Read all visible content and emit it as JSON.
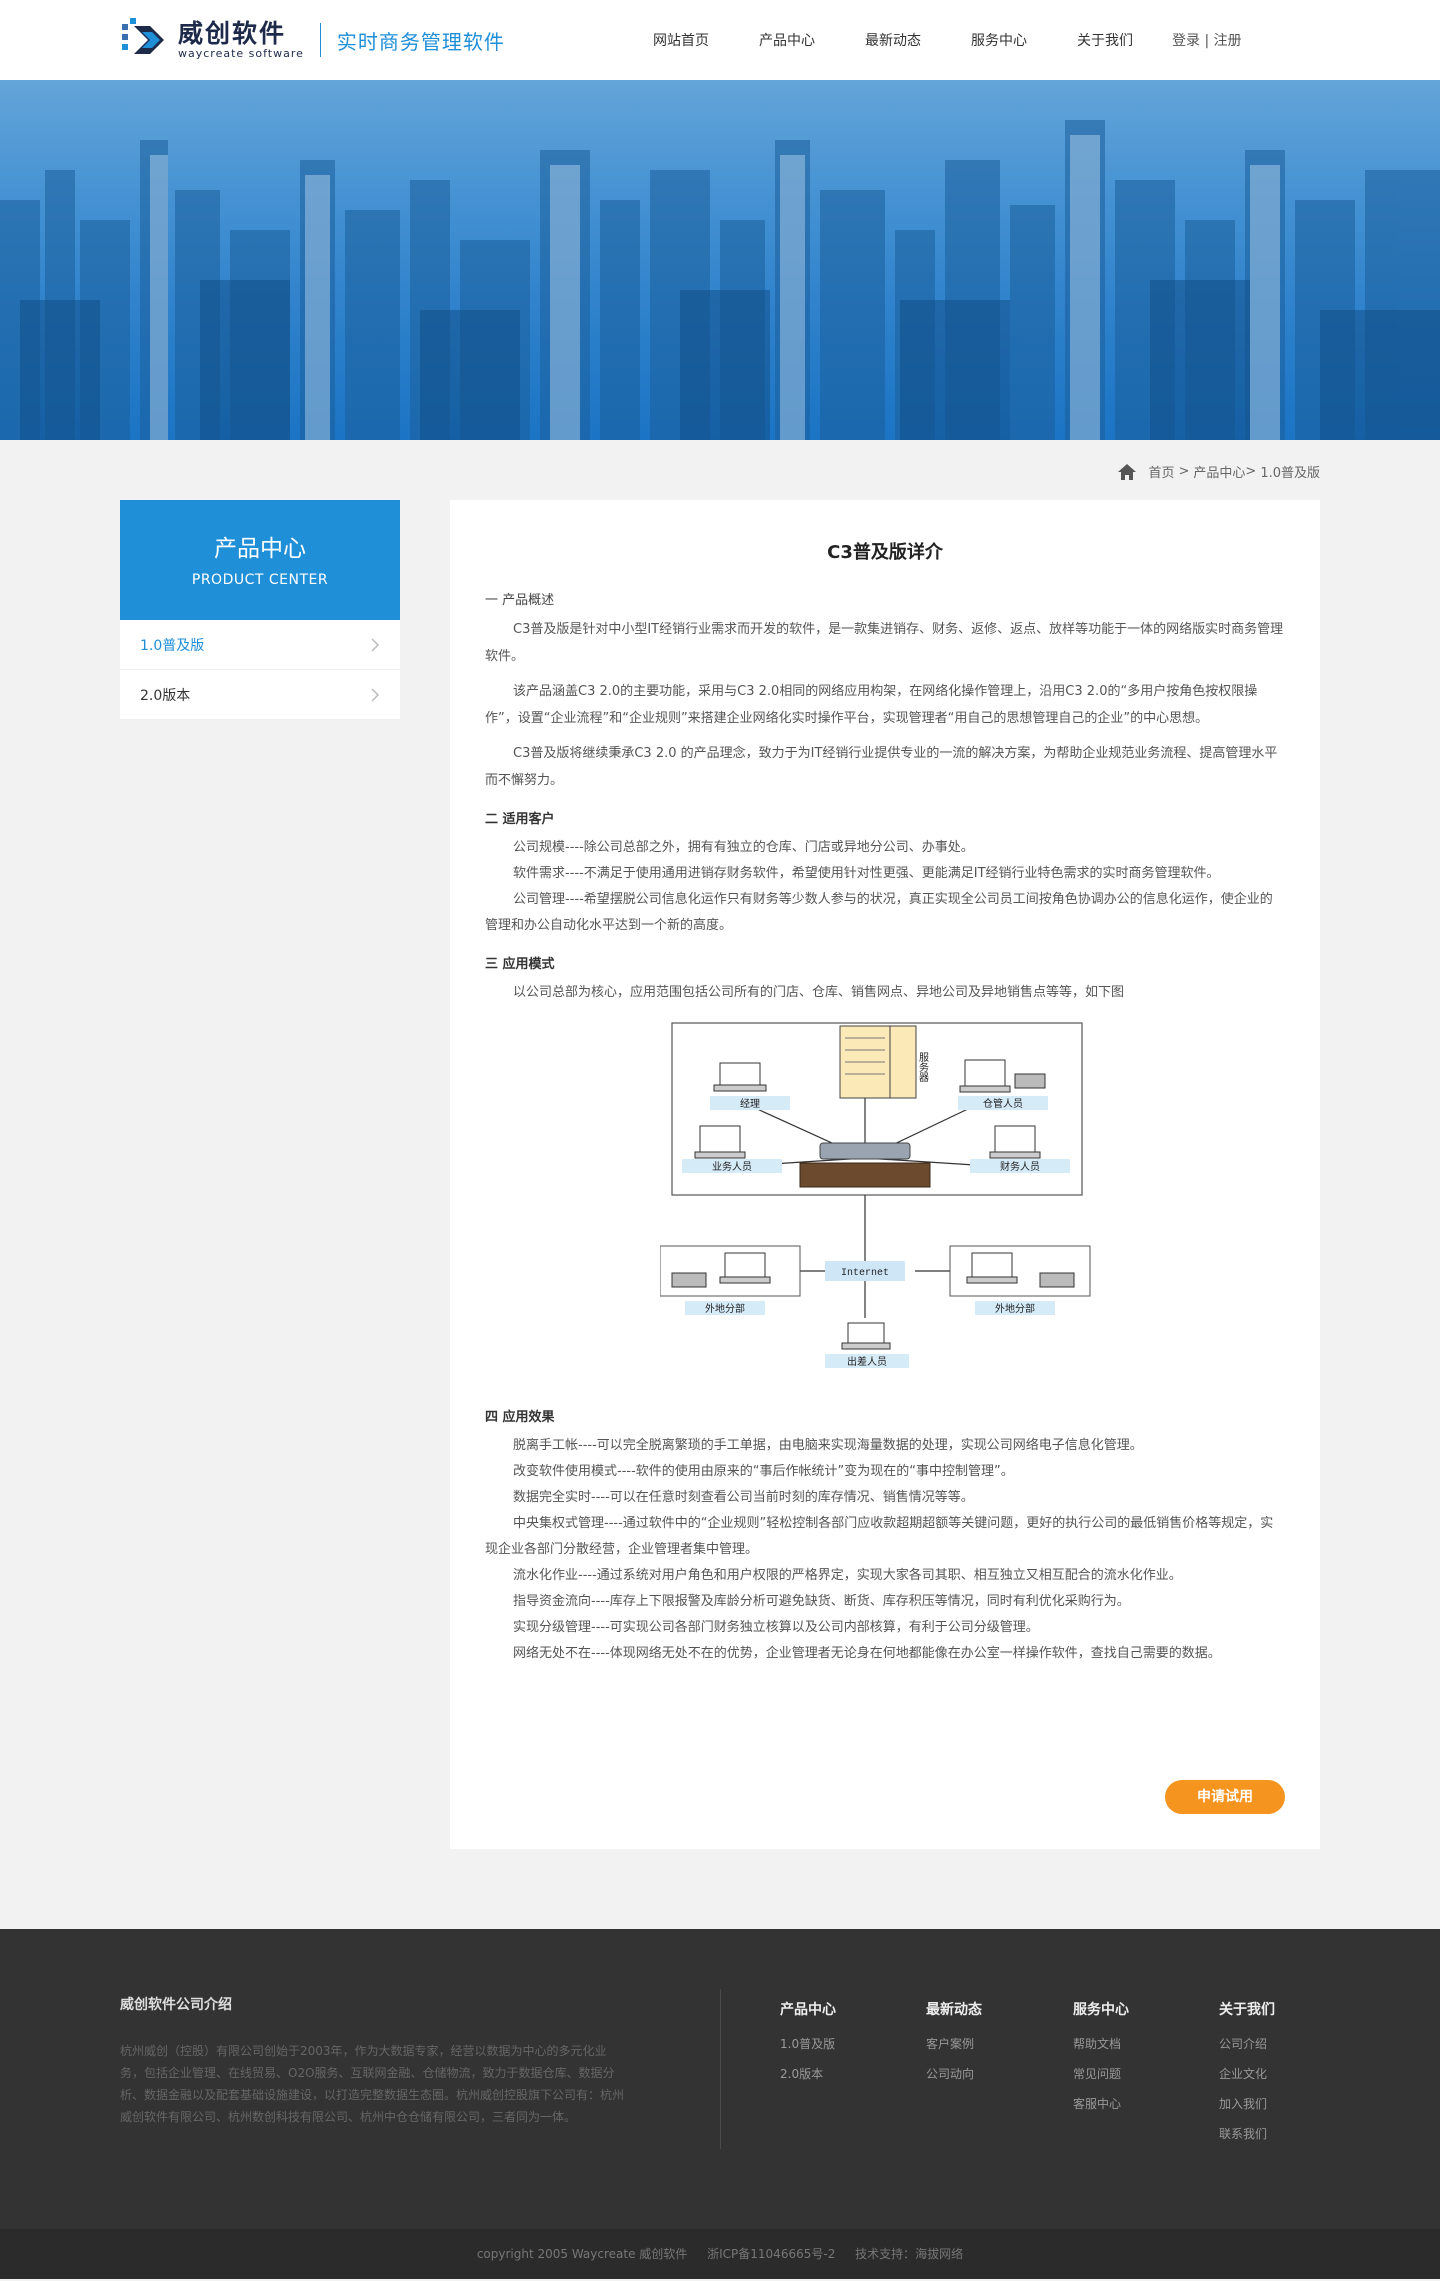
{
  "header": {
    "logo_cn": "威创软件",
    "logo_en": "waycreate software",
    "slogan": "实时商务管理软件",
    "nav": [
      "网站首页",
      "产品中心",
      "最新动态",
      "服务中心",
      "关于我们"
    ],
    "login": "登录",
    "separator": "|",
    "register": "注册"
  },
  "breadcrumb": {
    "home": "首页",
    "sep1": ">",
    "section": "产品中心",
    "sep2": ">",
    "current": "1.0普及版"
  },
  "sidebar": {
    "title_cn": "产品中心",
    "title_en": "PRODUCT CENTER",
    "items": [
      "1.0普及版",
      "2.0版本"
    ]
  },
  "article": {
    "title": "C3普及版详介",
    "s1_title": "一 产品概述",
    "s1_p1": "C3普及版是针对中小型IT经销行业需求而开发的软件，是一款集进销存、财务、返修、返点、放样等功能于一体的网络版实时商务管理软件。",
    "s1_p2": "该产品涵盖C3 2.0的主要功能，采用与C3 2.0相同的网络应用构架，在网络化操作管理上，沿用C3 2.0的“多用户按角色按权限操作”，设置“企业流程”和“企业规则”来搭建企业网络化实时操作平台，实现管理者“用自己的思想管理自己的企业”的中心思想。",
    "s1_p3": "C3普及版将继续秉承C3 2.0 的产品理念，致力于为IT经销行业提供专业的一流的解决方案，为帮助企业规范业务流程、提高管理水平而不懈努力。",
    "s2_title": "二 适用客户",
    "s2_lines": [
      "公司规模----除公司总部之外，拥有有独立的仓库、门店或异地分公司、办事处。",
      "软件需求----不满足于使用通用进销存财务软件，希望使用针对性更强、更能满足IT经销行业特色需求的实时商务管理软件。",
      "公司管理----希望摆脱公司信息化运作只有财务等少数人参与的状况，真正实现全公司员工间按角色协调办公的信息化运作，使企业的管理和办公自动化水平达到一个新的高度。"
    ],
    "s3_title": "三 应用模式",
    "s3_p": "以公司总部为核心，应用范围包括公司所有的门店、仓库、销售网点、异地公司及异地销售点等等，如下图",
    "diagram": {
      "server": "服务器",
      "manager": "经理",
      "warehouse": "仓管人员",
      "sales": "业务人员",
      "finance": "财务人员",
      "internet": "Internet",
      "branch_left": "外地分部",
      "branch_right": "外地分部",
      "traveler": "出差人员"
    },
    "s4_title": "四 应用效果",
    "s4_lines": [
      "脱离手工帐----可以完全脱离繁琐的手工单据，由电脑来实现海量数据的处理，实现公司网络电子信息化管理。",
      "改变软件使用模式----软件的使用由原来的“事后作帐统计”变为现在的“事中控制管理”。",
      "数据完全实时----可以在任意时刻查看公司当前时刻的库存情况、销售情况等等。",
      "中央集权式管理----通过软件中的“企业规则”轻松控制各部门应收款超期超额等关键问题，更好的执行公司的最低销售价格等规定，实现企业各部门分散经营，企业管理者集中管理。",
      "流水化作业----通过系统对用户角色和用户权限的严格界定，实现大家各司其职、相互独立又相互配合的流水化作业。",
      "指导资金流向----库存上下限报警及库龄分析可避免缺货、断货、库存积压等情况，同时有利优化采购行为。",
      "实现分级管理----可实现公司各部门财务独立核算以及公司内部核算，有利于公司分级管理。",
      "网络无处不在----体现网络无处不在的优势，企业管理者无论身在何地都能像在办公室一样操作软件，查找自己需要的数据。"
    ],
    "apply_button": "申请试用"
  },
  "footer": {
    "about_title": "威创软件公司介绍",
    "about_text": "杭州威创（控股）有限公司创始于2003年，作为大数据专家，经营以数据为中心的多元化业务，包括企业管理、在线贸易、O2O服务、互联网金融、仓储物流，致力于数据仓库、数据分析、数据金融以及配套基础设施建设，以打造完整数据生态圈。杭州威创控股旗下公司有：杭州威创软件有限公司、杭州数创科技有限公司、杭州中仓仓储有限公司，三者同为一体。",
    "cols": [
      {
        "title": "产品中心",
        "links": [
          "1.0普及版",
          "2.0版本"
        ]
      },
      {
        "title": "最新动态",
        "links": [
          "客户案例",
          "公司动向"
        ]
      },
      {
        "title": "服务中心",
        "links": [
          "帮助文档",
          "常见问题",
          "客服中心"
        ]
      },
      {
        "title": "关于我们",
        "links": [
          "公司介绍",
          "企业文化",
          "加入我们",
          "联系我们"
        ]
      }
    ],
    "copyright": "copyright 2005 Waycreate 威创软件",
    "icp": "浙ICP备11046665号-2",
    "support": "技术支持：海拔网络"
  },
  "colors": {
    "brand_blue": "#1f8fd8",
    "accent_orange": "#f5941f",
    "footer_bg": "#333333"
  }
}
